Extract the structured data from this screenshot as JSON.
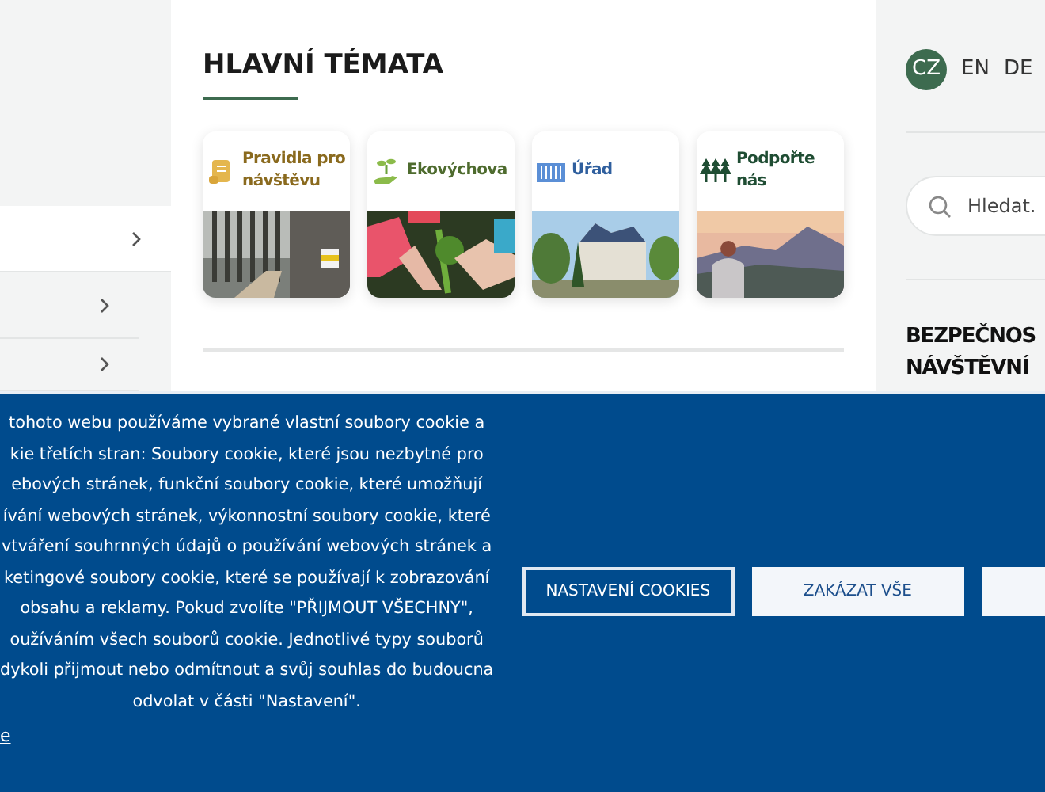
{
  "sidebar": {
    "items": [
      {
        "selected": true
      },
      {
        "selected": false
      },
      {
        "selected": false
      }
    ]
  },
  "main": {
    "heading": "HLAVNÍ TÉMATA",
    "topics": [
      {
        "kind": "scroll",
        "title": "Pravidla pro návštěvu",
        "color": "#8a6a1e"
      },
      {
        "kind": "sprout",
        "title": "Ekovýchova",
        "color": "#4e6b2e"
      },
      {
        "kind": "building",
        "title": "Úřad",
        "color": "#2f5f9e"
      },
      {
        "kind": "trees",
        "title": "Podpořte nás",
        "color": "#1f4d33"
      }
    ]
  },
  "right_panel": {
    "languages": [
      {
        "code": "CZ",
        "selected": true
      },
      {
        "code": "EN",
        "selected": false
      },
      {
        "code": "DE",
        "selected": false
      }
    ],
    "search": {
      "placeholder": "Hledat."
    },
    "heading_lines": [
      "BEZPEČNOS",
      "NÁVŠTĚVNÍ"
    ]
  },
  "cookie_banner": {
    "text_lines": [
      "tohoto webu používáme vybrané vlastní soubory cookie a",
      "kie třetích stran: Soubory cookie, které jsou nezbytné pro",
      "ebových stránek, funkční soubory cookie, které umožňují",
      "ívání webových stránek, výkonnostní soubory cookie, které",
      "vtváření souhrnných údajů o používání webových stránek a",
      "ketingové soubory cookie, které se používají k zobrazování",
      "obsahu a reklamy. Pokud zvolíte \"PŘIJMOUT VŠECHNY\",",
      "oužíváním všech souborů cookie. Jednotlivé typy souborů",
      "dykoli přijmout nebo odmítnout a svůj souhlas do budoucna",
      "odvolat v části \"Nastavení\"."
    ],
    "link": "e",
    "buttons": [
      {
        "kind": "outline",
        "label": "NASTAVENÍ COOKIES"
      },
      {
        "kind": "solid",
        "label": "ZAKÁZAT VŠE"
      },
      {
        "kind": "solid"
      }
    ]
  }
}
